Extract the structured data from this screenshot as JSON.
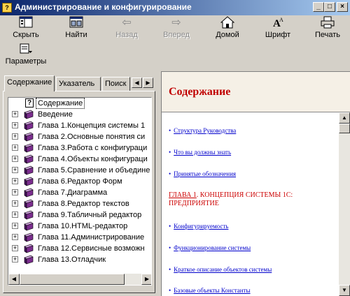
{
  "window": {
    "title": "Администрирование и конфигурирование",
    "controls": {
      "minimize": "_",
      "maximize": "□",
      "close": "×"
    }
  },
  "toolbar": {
    "hide": {
      "label": "Скрыть",
      "icon": "hide-icon"
    },
    "find": {
      "label": "Найти",
      "icon": "find-icon"
    },
    "back": {
      "label": "Назад",
      "icon": "arrow-left-icon",
      "enabled": false
    },
    "forward": {
      "label": "Вперед",
      "icon": "arrow-right-icon",
      "enabled": false
    },
    "home": {
      "label": "Домой",
      "icon": "home-icon"
    },
    "font": {
      "label": "Шрифт",
      "icon": "font-icon"
    },
    "print": {
      "label": "Печать",
      "icon": "printer-icon"
    },
    "options": {
      "label": "Параметры",
      "icon": "options-icon"
    }
  },
  "tabs": [
    {
      "label": "Содержание",
      "active": true
    },
    {
      "label": "Указатель",
      "active": false
    },
    {
      "label": "Поиск",
      "active": false
    }
  ],
  "tree": {
    "root": "Содержание",
    "items": [
      {
        "label": "Введение"
      },
      {
        "label": "Глава 1.Концепция системы 1"
      },
      {
        "label": "Глава 2.Основные понятия си"
      },
      {
        "label": "Глава 3.Работа с конфигураци"
      },
      {
        "label": "Глава 4.Объекты конфигураци"
      },
      {
        "label": "Глава 5.Сравнение и объедине"
      },
      {
        "label": "Глава 6.Редактор Форм"
      },
      {
        "label": "Глава 7.Диаграмма"
      },
      {
        "label": "Глава 8.Редактор текстов"
      },
      {
        "label": "Глава 9.Табличный редактор"
      },
      {
        "label": "Глава 10.HTML-редактор"
      },
      {
        "label": "Глава 11.Администрирование"
      },
      {
        "label": "Глава 12.Сервисные возможн"
      },
      {
        "label": "Глава 13.Отладчик"
      }
    ]
  },
  "content": {
    "title": "Содержание",
    "links_top": [
      {
        "label": "Структура Руководства"
      },
      {
        "label": "Что вы должны знать"
      },
      {
        "label": "Принятые обозначения"
      }
    ],
    "chapter1": {
      "link": "ГЛАВА 1",
      "rest": ". КОНЦЕПЦИЯ СИСТЕМЫ 1С: ПРЕДПРИЯТИЕ"
    },
    "links_ch1": [
      {
        "label": "Конфигурируемость"
      },
      {
        "label": "Функционирование системы"
      },
      {
        "label": "Краткое описание объектов системы"
      }
    ],
    "partial_line": "Базовые объекты Константы"
  },
  "colors": {
    "titlebar_start": "#0a246a",
    "titlebar_end": "#a6caf0",
    "content_title": "#c00000",
    "link": "#0000cc",
    "book": "#7b2d8e"
  }
}
